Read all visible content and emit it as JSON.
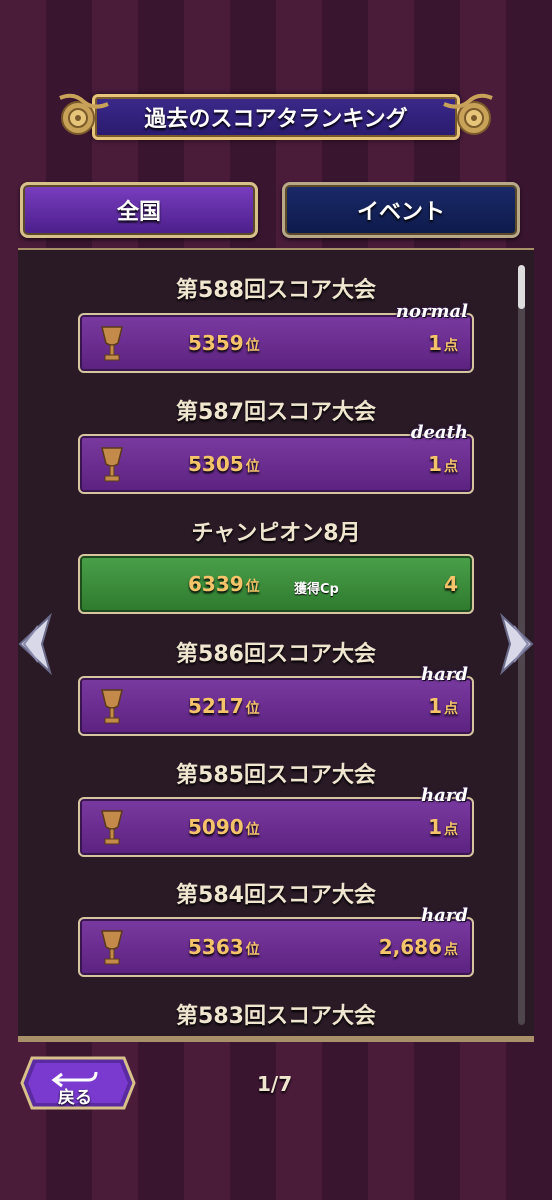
{
  "header": {
    "title": "過去のスコアタランキング"
  },
  "tabs": [
    {
      "label": "全国",
      "active": true
    },
    {
      "label": "イベント",
      "active": false
    }
  ],
  "entries": [
    {
      "title": "第588回スコア大会",
      "badge": "normal",
      "rank": "5359",
      "rank_suffix": "位",
      "points": "1",
      "points_unit": "点"
    },
    {
      "title": "第587回スコア大会",
      "badge": "death",
      "rank": "5305",
      "rank_suffix": "位",
      "points": "1",
      "points_unit": "点"
    },
    {
      "title": "チャンピオン8月",
      "rank": "6339",
      "rank_suffix": "位",
      "cp_label": "獲得Cp",
      "points": "4"
    },
    {
      "title": "第586回スコア大会",
      "badge": "hard",
      "rank": "5217",
      "rank_suffix": "位",
      "points": "1",
      "points_unit": "点"
    },
    {
      "title": "第585回スコア大会",
      "badge": "hard",
      "rank": "5090",
      "rank_suffix": "位",
      "points": "1",
      "points_unit": "点"
    },
    {
      "title": "第584回スコア大会",
      "badge": "hard",
      "rank": "5363",
      "rank_suffix": "位",
      "points": "2,686",
      "points_unit": "点"
    },
    {
      "title": "第583回スコア大会"
    }
  ],
  "footer": {
    "back_label": "戻る",
    "page": "1/7"
  },
  "colors": {
    "gold": "#f5c46a",
    "purple_row": "#6a2c90",
    "green_row": "#3a8a3a"
  },
  "icons": [
    "trophy-icon",
    "left-arrow-icon",
    "right-arrow-icon",
    "back-arrow-icon"
  ]
}
